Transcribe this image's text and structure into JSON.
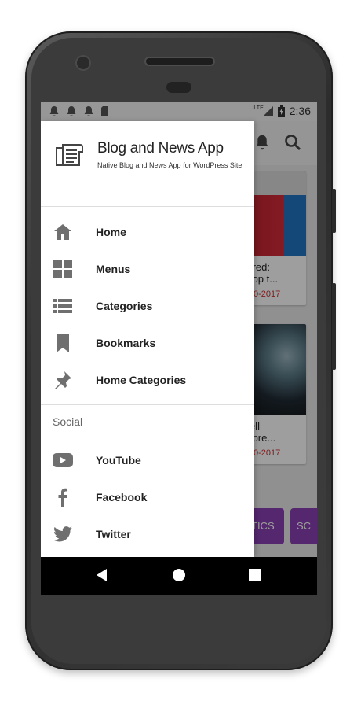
{
  "status_bar": {
    "time": "2:36",
    "network": "LTE"
  },
  "drawer": {
    "app_title": "Blog and News App",
    "app_subtitle": "Native Blog and News App for WordPress Site",
    "menu": [
      {
        "label": "Home",
        "icon": "home-icon"
      },
      {
        "label": "Menus",
        "icon": "grid-icon"
      },
      {
        "label": "Categories",
        "icon": "list-icon"
      },
      {
        "label": "Bookmarks",
        "icon": "bookmark-icon"
      },
      {
        "label": "Home Categories",
        "icon": "pin-icon"
      }
    ],
    "social_heading": "Social",
    "social": [
      {
        "label": "YouTube",
        "icon": "youtube-icon"
      },
      {
        "label": "Facebook",
        "icon": "facebook-icon"
      },
      {
        "label": "Twitter",
        "icon": "twitter-icon"
      }
    ]
  },
  "background": {
    "cards": [
      {
        "title_line1": "equired:",
        "title_line2": "o shop t...",
        "date": "19-10-2017"
      },
      {
        "title_line1": "to sell",
        "title_line2": "e in pre...",
        "date": "19-10-2017"
      }
    ],
    "chips": [
      "TICS",
      "SC"
    ]
  },
  "colors": {
    "accent_purple": "#8a3fb3",
    "date_red": "#cc3333",
    "icon_gray": "#6f6f6f"
  }
}
